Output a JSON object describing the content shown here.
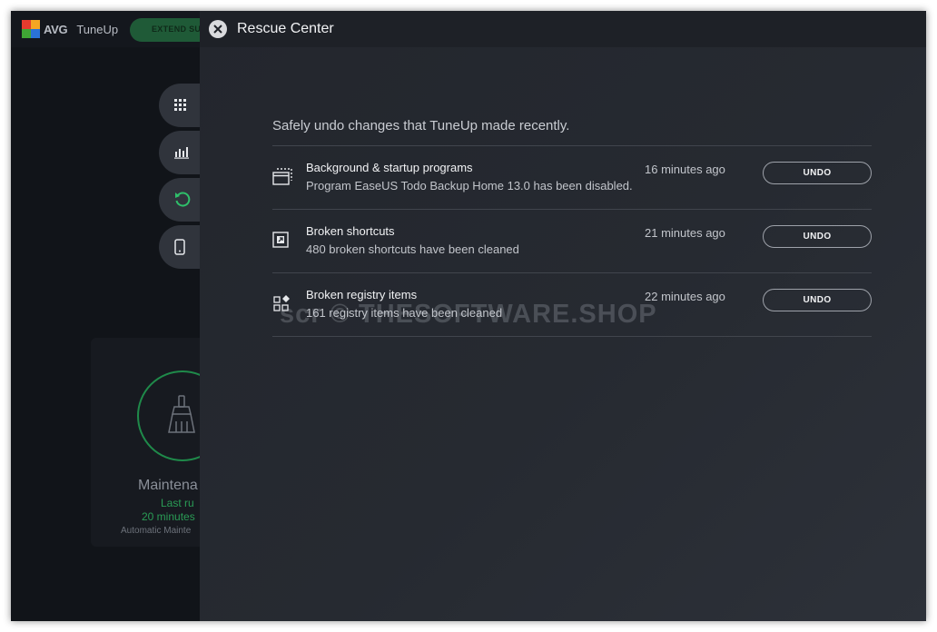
{
  "background": {
    "logo_text": "AVG",
    "logo_sub": "TuneUp",
    "extend_label": "EXTEND SU",
    "maintenance": {
      "title": "Maintena",
      "last_run": "Last ru",
      "time": "20 minutes",
      "auto": "Automatic Mainte"
    },
    "colors": {
      "accent_green": "#2a9c55"
    }
  },
  "overlay": {
    "title": "Rescue Center",
    "intro": "Safely undo changes that TuneUp made recently.",
    "items": [
      {
        "icon": "window-stack-icon",
        "title": "Background & startup programs",
        "desc": "Program EaseUS Todo Backup Home 13.0 has been disabled.",
        "time": "16 minutes ago",
        "undo": "UNDO"
      },
      {
        "icon": "shortcut-arrow-icon",
        "title": "Broken shortcuts",
        "desc": "480 broken shortcuts have been cleaned",
        "time": "21 minutes ago",
        "undo": "UNDO"
      },
      {
        "icon": "registry-grid-icon",
        "title": "Broken registry items",
        "desc": "161 registry items have been cleaned",
        "time": "22 minutes ago",
        "undo": "UNDO"
      }
    ]
  },
  "watermark": "scr © THESOFTWARE.SHOP"
}
